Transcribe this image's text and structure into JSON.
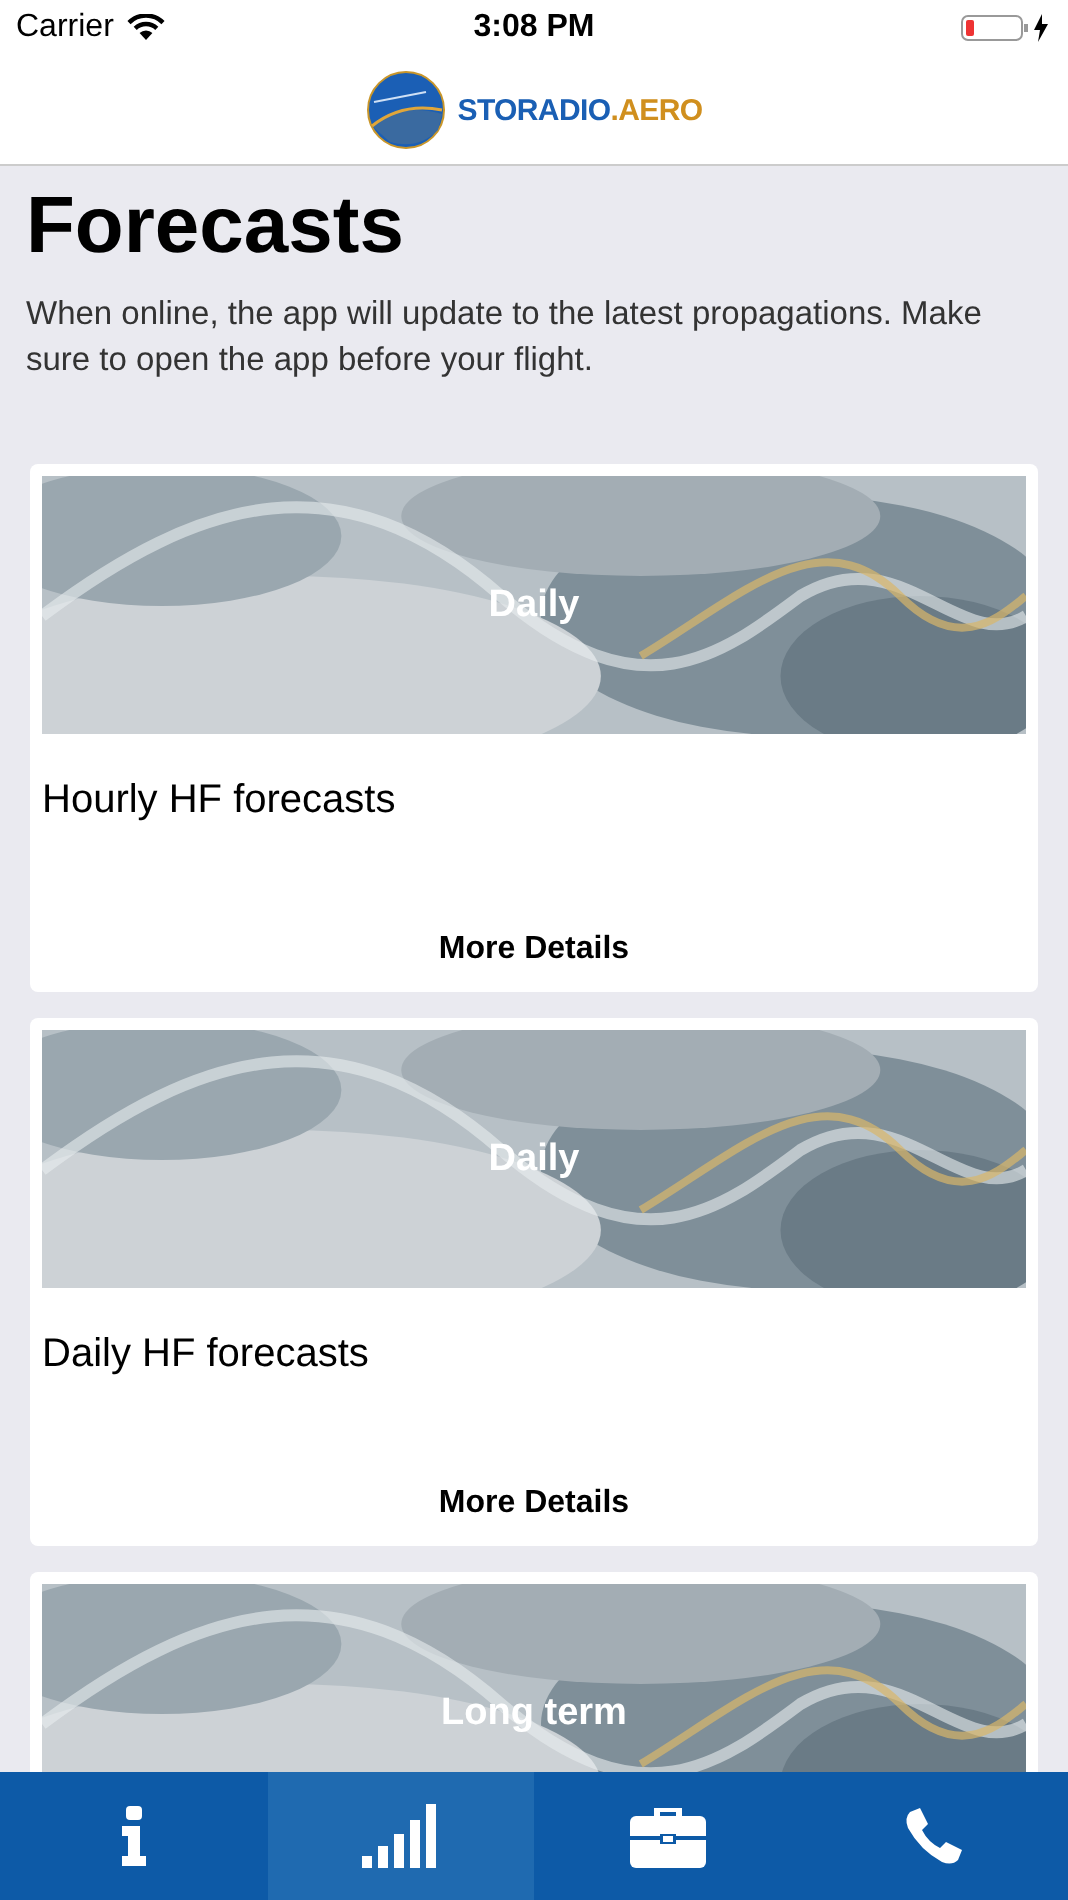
{
  "status_bar": {
    "carrier": "Carrier",
    "time": "3:08 PM"
  },
  "header": {
    "brand_primary": "STORADIO",
    "brand_secondary": ".AERO"
  },
  "page": {
    "title": "Forecasts",
    "description": "When online, the app will update to the latest propagations. Make sure to open the app before your flight."
  },
  "cards": [
    {
      "banner_label": "Daily",
      "title": "Hourly HF forecasts",
      "action": "More Details"
    },
    {
      "banner_label": "Daily",
      "title": "Daily HF forecasts",
      "action": "More Details"
    },
    {
      "banner_label": "Long term"
    }
  ],
  "tab_bar": [
    {
      "kind": "info",
      "selected": false
    },
    {
      "kind": "signal",
      "selected": true
    },
    {
      "kind": "briefcase",
      "selected": false
    },
    {
      "kind": "phone",
      "selected": false
    }
  ]
}
